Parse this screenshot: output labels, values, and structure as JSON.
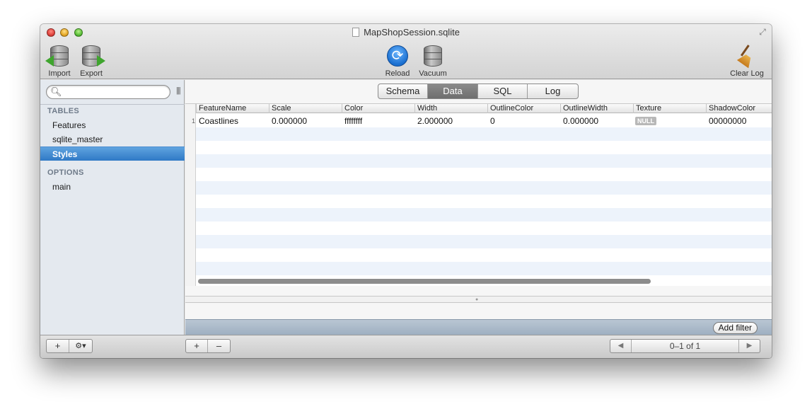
{
  "window": {
    "title": "MapShopSession.sqlite"
  },
  "toolbar": {
    "import_label": "Import",
    "export_label": "Export",
    "reload_label": "Reload",
    "vacuum_label": "Vacuum",
    "clear_log_label": "Clear Log"
  },
  "sidebar": {
    "search_placeholder": "",
    "tables_header": "TABLES",
    "tables": [
      "Features",
      "sqlite_master",
      "Styles"
    ],
    "selected_table": "Styles",
    "options_header": "OPTIONS",
    "options": [
      "main"
    ]
  },
  "tabs": [
    "Schema",
    "Data",
    "SQL",
    "Log"
  ],
  "active_tab": "Data",
  "grid": {
    "columns": [
      "FeatureName",
      "Scale",
      "Color",
      "Width",
      "OutlineColor",
      "OutlineWidth",
      "Texture",
      "ShadowColor"
    ],
    "rows": [
      {
        "num": "1",
        "cells": [
          "Coastlines",
          "0.000000",
          "ffffffff",
          "2.000000",
          "0",
          "0.000000",
          "NULL",
          "00000000"
        ]
      }
    ]
  },
  "filter": {
    "add_filter_label": "Add filter"
  },
  "bottom": {
    "sidebar_add": "+",
    "sidebar_gear": "⚙▾",
    "row_add": "+",
    "row_remove": "–",
    "page_prev": "◀",
    "page_next": "▶",
    "page_info": "0–1 of 1"
  },
  "colors": {
    "selection": "#3d86cf",
    "stripe": "#edf3fb",
    "filter_bar": "#a9b8c8"
  }
}
